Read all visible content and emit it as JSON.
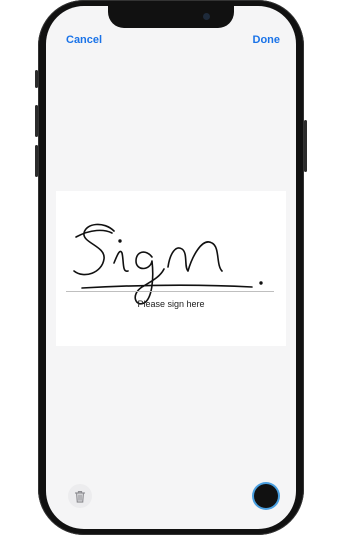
{
  "header": {
    "cancel_label": "Cancel",
    "done_label": "Done"
  },
  "signature": {
    "prompt": "Please sign here",
    "ink_color": "#111111"
  },
  "toolbar": {
    "trash_icon": "trash-icon",
    "color_swatch": "#111111",
    "swatch_ring_color": "#4a9fe0"
  },
  "colors": {
    "accent": "#1a73e8",
    "screen_background": "#f5f5f6",
    "panel_background": "#ffffff"
  }
}
